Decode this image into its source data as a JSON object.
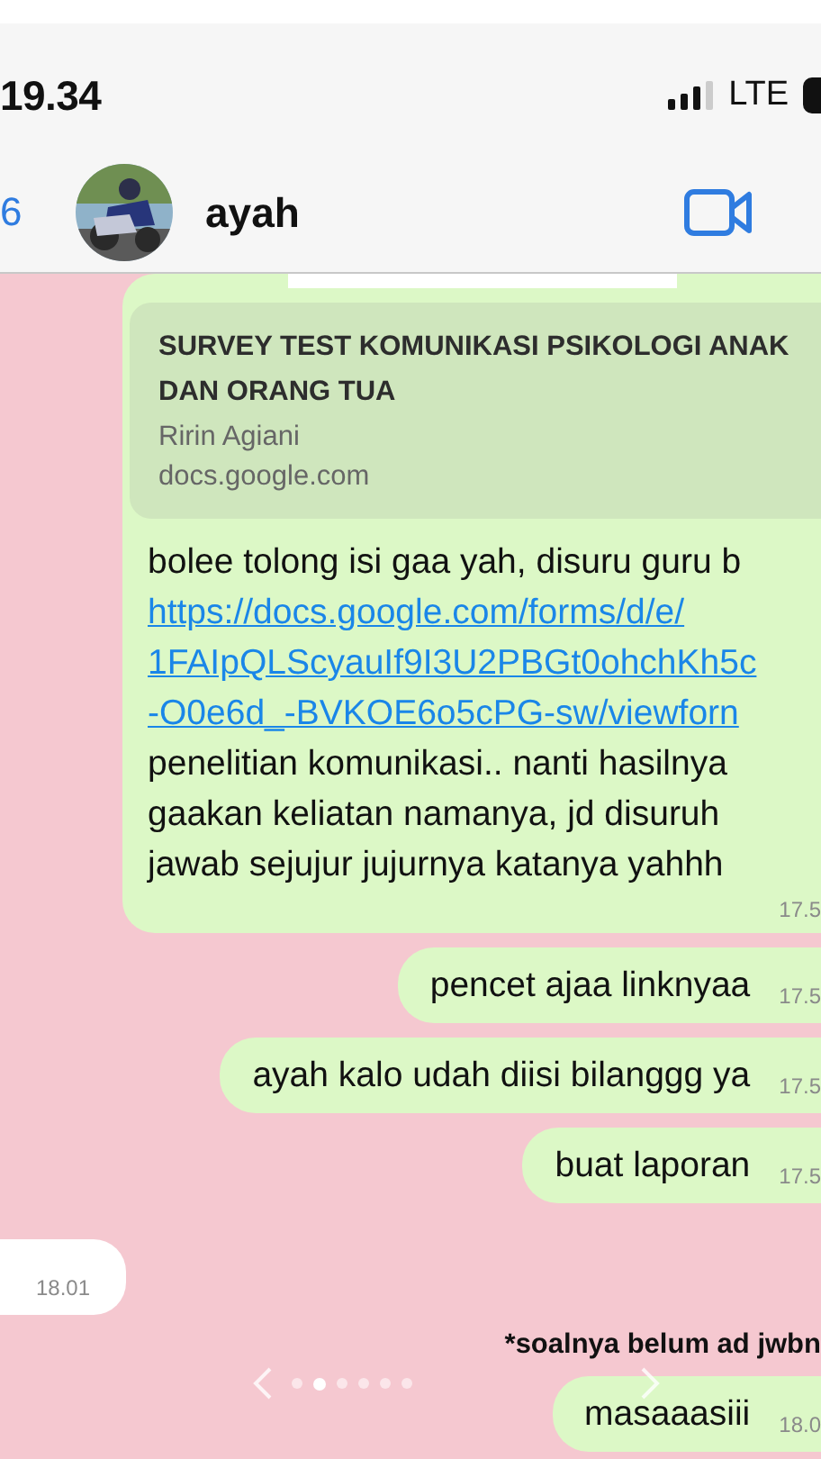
{
  "status_bar": {
    "time": "19.34",
    "network": "LTE"
  },
  "header": {
    "back_count": "6",
    "contact_name": "ayah"
  },
  "messages": [
    {
      "kind": "link_preview",
      "preview": {
        "title": "SURVEY TEST KOMUNIKASI PSIKOLOGI ANAK DAN ORANG TUA",
        "author": "Ririn Agiani",
        "domain": "docs.google.com"
      },
      "segments": [
        {
          "kind": "text",
          "lines": [
            "bolee tolong isi gaa yah, disuru guru b"
          ]
        },
        {
          "kind": "link",
          "lines": [
            "https://docs.google.com/forms/d/e/",
            "1FAIpQLScyauIf9I3U2PBGt0ohchKh5c",
            "-O0e6d_-BVKOE6o5cPG-sw/viewforn"
          ]
        },
        {
          "kind": "text",
          "lines": [
            "penelitian komunikasi.. nanti hasilnya",
            "gaakan keliatan namanya, jd disuruh",
            "jawab sejujur jujurnya katanya yahhh"
          ]
        }
      ],
      "time": "17.5"
    },
    {
      "kind": "text",
      "text": "pencet ajaa linknyaa",
      "time": "17.5"
    },
    {
      "kind": "text",
      "text": "ayah kalo udah diisi bilanggg ya",
      "time": "17.5"
    },
    {
      "kind": "text",
      "text": "buat laporan",
      "time": "17.5"
    },
    {
      "kind": "incoming_time_only",
      "time": "18.01"
    },
    {
      "kind": "caption",
      "text": "*soalnya belum ad jwbn"
    },
    {
      "kind": "text",
      "text": "masaaasiii",
      "time": "18.0"
    }
  ],
  "pager": {
    "pages": [
      {
        "selected": false
      },
      {
        "selected": true
      },
      {
        "selected": false
      },
      {
        "selected": false
      },
      {
        "selected": false
      },
      {
        "selected": false
      }
    ]
  }
}
